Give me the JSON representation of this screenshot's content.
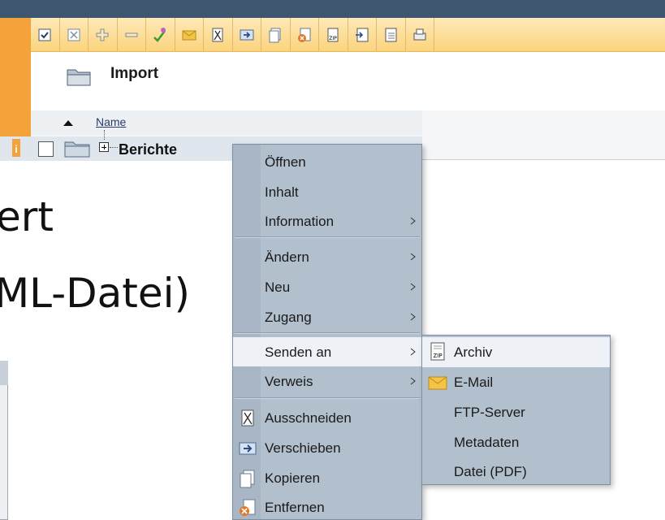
{
  "folder": {
    "title": "Import"
  },
  "table": {
    "column_name": "Name",
    "row_label": "Berichte"
  },
  "slide": {
    "line1": "ert",
    "line2": "ML-Datei)"
  },
  "toolbar_icons": [
    "check-box-icon",
    "uncheck-box-icon",
    "plus-icon",
    "minus-icon",
    "wand-icon",
    "mail-icon",
    "scissors-icon",
    "move-icon",
    "copy-icon",
    "delete-icon",
    "zip-icon",
    "export-icon",
    "import-icon",
    "printer-icon"
  ],
  "context_menu": {
    "items": [
      {
        "label": "Öffnen"
      },
      {
        "label": "Inhalt"
      },
      {
        "label": "Information"
      },
      {
        "label": "Ändern"
      },
      {
        "label": "Neu"
      },
      {
        "label": "Zugang"
      },
      {
        "label": "Senden an"
      },
      {
        "label": "Verweis"
      },
      {
        "label": "Ausschneiden"
      },
      {
        "label": "Verschieben"
      },
      {
        "label": "Kopieren"
      },
      {
        "label": "Entfernen"
      }
    ]
  },
  "submenu": {
    "items": [
      {
        "label": "Archiv"
      },
      {
        "label": "E-Mail"
      },
      {
        "label": "FTP-Server"
      },
      {
        "label": "Metadaten"
      },
      {
        "label": "Datei (PDF)"
      }
    ]
  },
  "colors": {
    "toolbar": "#fbd47d",
    "accent_orange": "#f4a23a",
    "menu_bg": "#b2bfcd",
    "highlight": "#eef1f5"
  }
}
